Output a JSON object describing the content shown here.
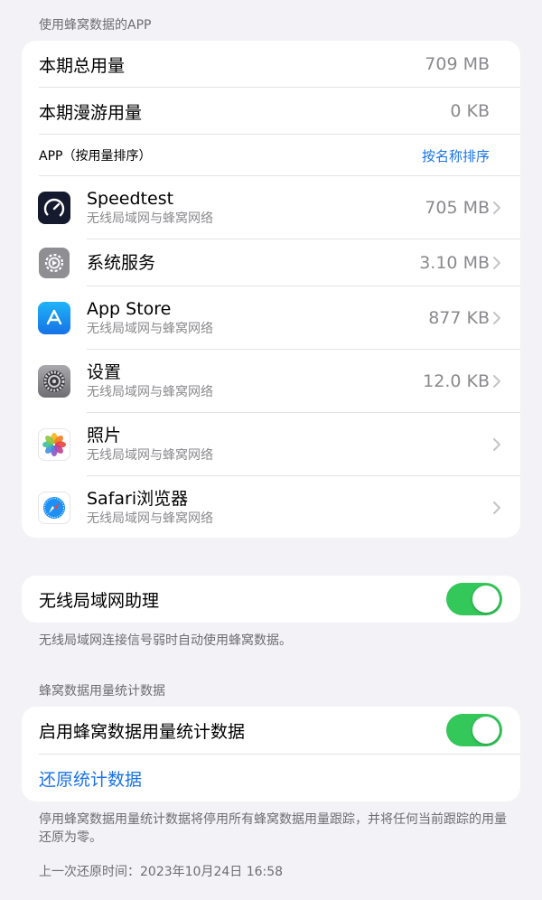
{
  "usage": {
    "header": "使用蜂窝数据的APP",
    "current_total_label": "本期总用量",
    "current_total_value": "709 MB",
    "roaming_label": "本期漫游用量",
    "roaming_value": "0 KB",
    "apps_header": "APP（按用量排序）",
    "sort_link": "按名称排序"
  },
  "apps": [
    {
      "name": "Speedtest",
      "sub": "无线局域网与蜂窝网络",
      "value": "705 MB",
      "icon": "speedtest-icon"
    },
    {
      "name": "系统服务",
      "sub": "",
      "value": "3.10 MB",
      "icon": "system-services-icon"
    },
    {
      "name": "App Store",
      "sub": "无线局域网与蜂窝网络",
      "value": "877 KB",
      "icon": "app-store-icon"
    },
    {
      "name": "设置",
      "sub": "无线局域网与蜂窝网络",
      "value": "12.0 KB",
      "icon": "settings-icon"
    },
    {
      "name": "照片",
      "sub": "无线局域网与蜂窝网络",
      "value": "",
      "icon": "photos-icon"
    },
    {
      "name": "Safari浏览器",
      "sub": "无线局域网与蜂窝网络",
      "value": "",
      "icon": "safari-icon"
    }
  ],
  "wifi_assist": {
    "label": "无线局域网助理",
    "enabled": true,
    "footnote": "无线局域网连接信号弱时自动使用蜂窝数据。"
  },
  "stats": {
    "header": "蜂窝数据用量统计数据",
    "enable_label": "启用蜂窝数据用量统计数据",
    "enabled": true,
    "reset_label": "还原统计数据",
    "footnote": "停用蜂窝数据用量统计数据将停用所有蜂窝数据用量跟踪，并将任何当前跟踪的用量还原为零。",
    "last_reset": "上一次还原时间：2023年10月24日 16:58"
  },
  "colors": {
    "accent": "#1a73e8",
    "toggle_on": "#34c759",
    "background": "#f2f2f7"
  }
}
